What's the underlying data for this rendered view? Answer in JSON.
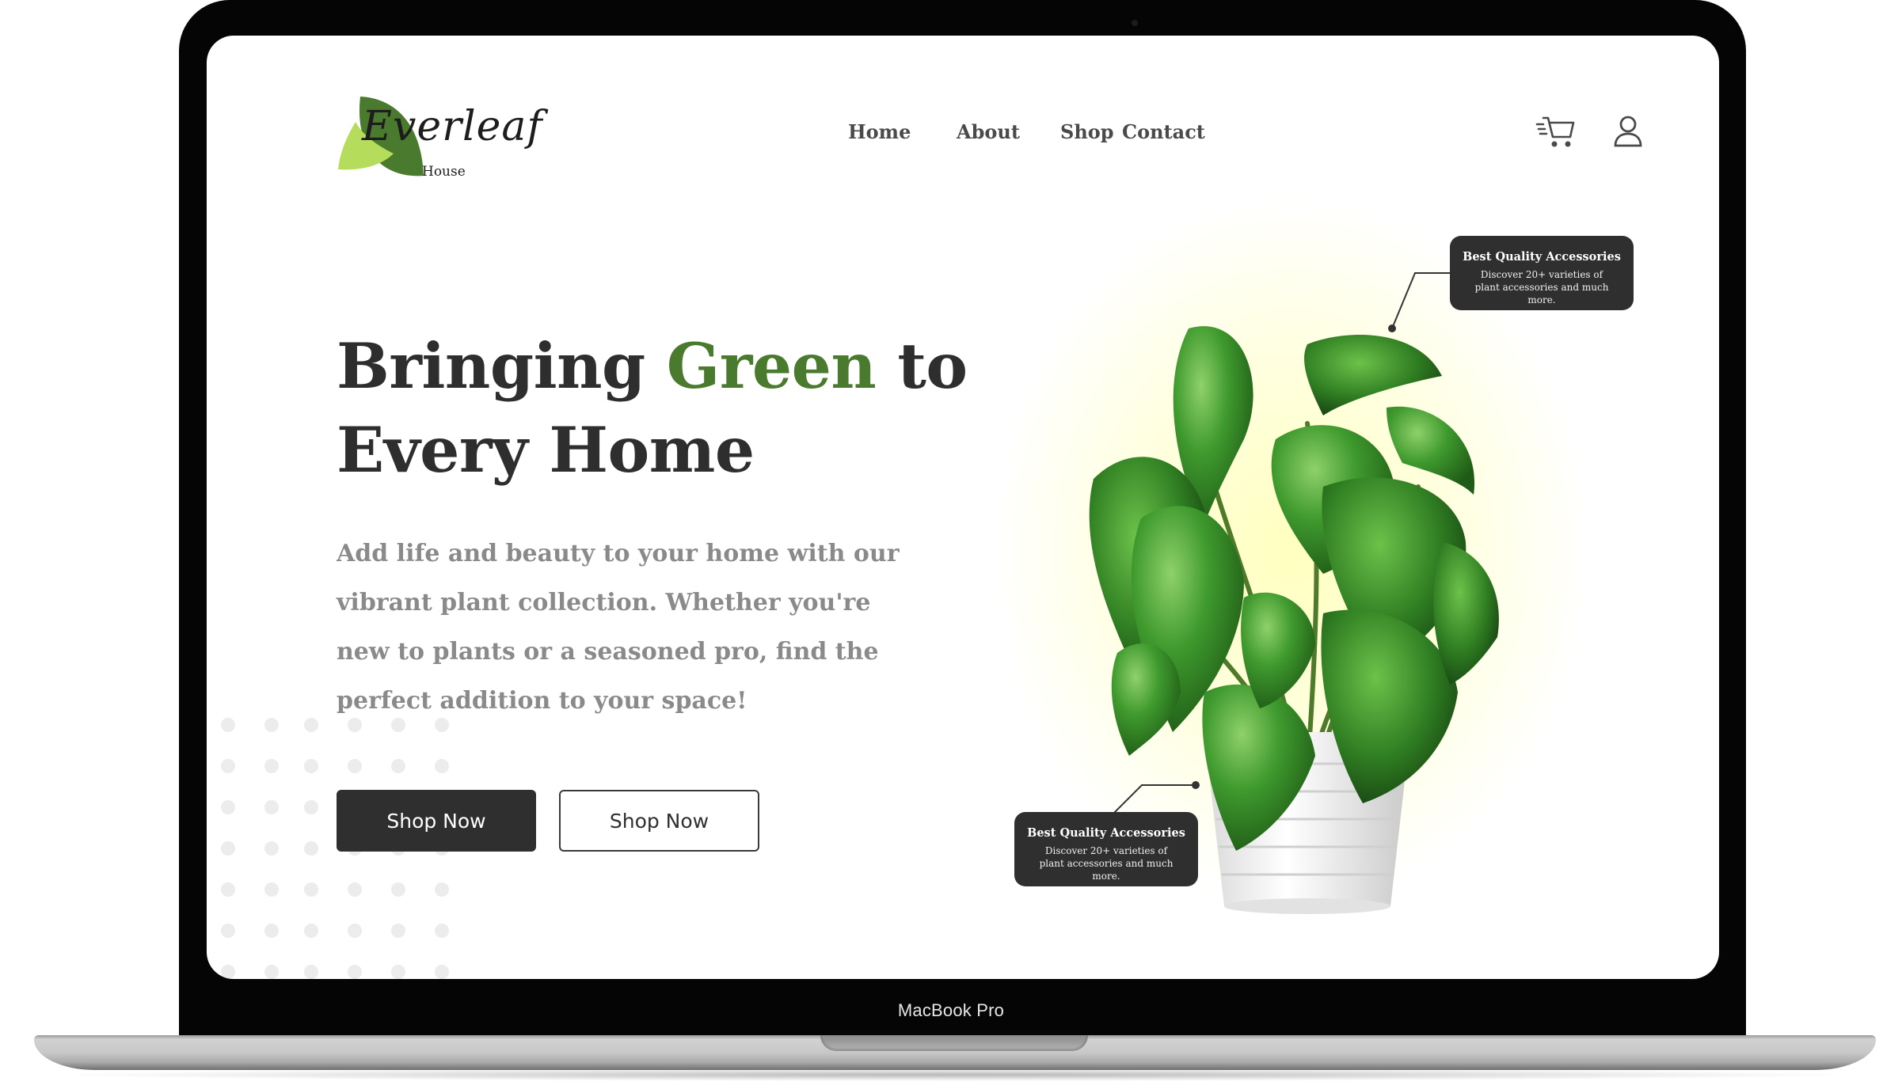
{
  "device": {
    "model_label": "MacBook Pro"
  },
  "brand": {
    "script_name": "Everleaf",
    "sub_name": "House",
    "leaf_dark": "#4a7a2e",
    "leaf_light": "#b5dc5a"
  },
  "nav": {
    "items": [
      "Home",
      "About",
      "Shop",
      "Contact"
    ]
  },
  "header_icons": {
    "cart": "cart-icon",
    "account": "user-icon"
  },
  "hero": {
    "title_part1": "Bringing ",
    "title_accent": "Green",
    "title_part2": " to",
    "title_line2": "Every Home",
    "accent_color": "#4a7a2e",
    "description": "Add life and beauty to your home with our vibrant plant collection. Whether you're new to plants or a seasoned pro, find the perfect addition to your space!",
    "primary_button": "Shop Now",
    "secondary_button": "Shop Now"
  },
  "callouts": [
    {
      "title": "Best Quality Accessories",
      "body": "Discover 20+ varieties of plant accessories and much more."
    },
    {
      "title": "Best Quality Accessories",
      "body": "Discover 20+ varieties of plant accessories and much more."
    }
  ]
}
